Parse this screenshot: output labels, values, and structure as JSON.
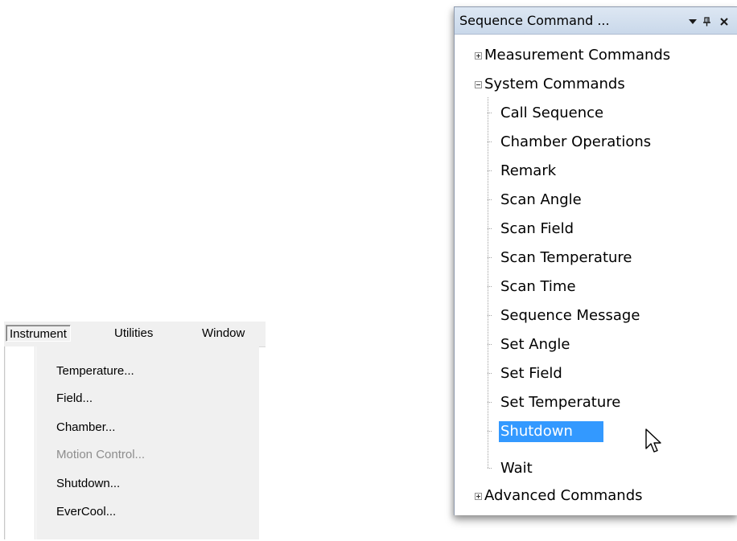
{
  "menubar": {
    "items": [
      "Instrument",
      "Utilities",
      "Window"
    ],
    "active_index": 0
  },
  "instrument_menu": {
    "items": [
      {
        "label": "Temperature...",
        "enabled": true
      },
      {
        "label": "Field...",
        "enabled": true
      },
      {
        "label": "Chamber...",
        "enabled": true
      },
      {
        "label": "Motion Control...",
        "enabled": false
      },
      {
        "label": "Shutdown...",
        "enabled": true
      },
      {
        "label": "EverCool...",
        "enabled": true
      }
    ]
  },
  "sequence_panel": {
    "title": "Sequence Command ...",
    "buttons": {
      "dropdown_icon": "dropdown-arrow-icon",
      "pin_icon": "pin-icon",
      "close_icon": "close-icon"
    },
    "tree": {
      "groups": [
        {
          "label": "Measurement Commands",
          "expanded": false
        },
        {
          "label": "System Commands",
          "expanded": true,
          "children": [
            "Call Sequence",
            "Chamber Operations",
            "Remark",
            "Scan Angle",
            "Scan Field",
            "Scan Temperature",
            "Scan Time",
            "Sequence Message",
            "Set Angle",
            "Set Field",
            "Set Temperature",
            "Shutdown",
            "Wait"
          ]
        },
        {
          "label": "Advanced Commands",
          "expanded": false
        }
      ],
      "selected": "Shutdown"
    },
    "selection_color": "#3399ff"
  }
}
